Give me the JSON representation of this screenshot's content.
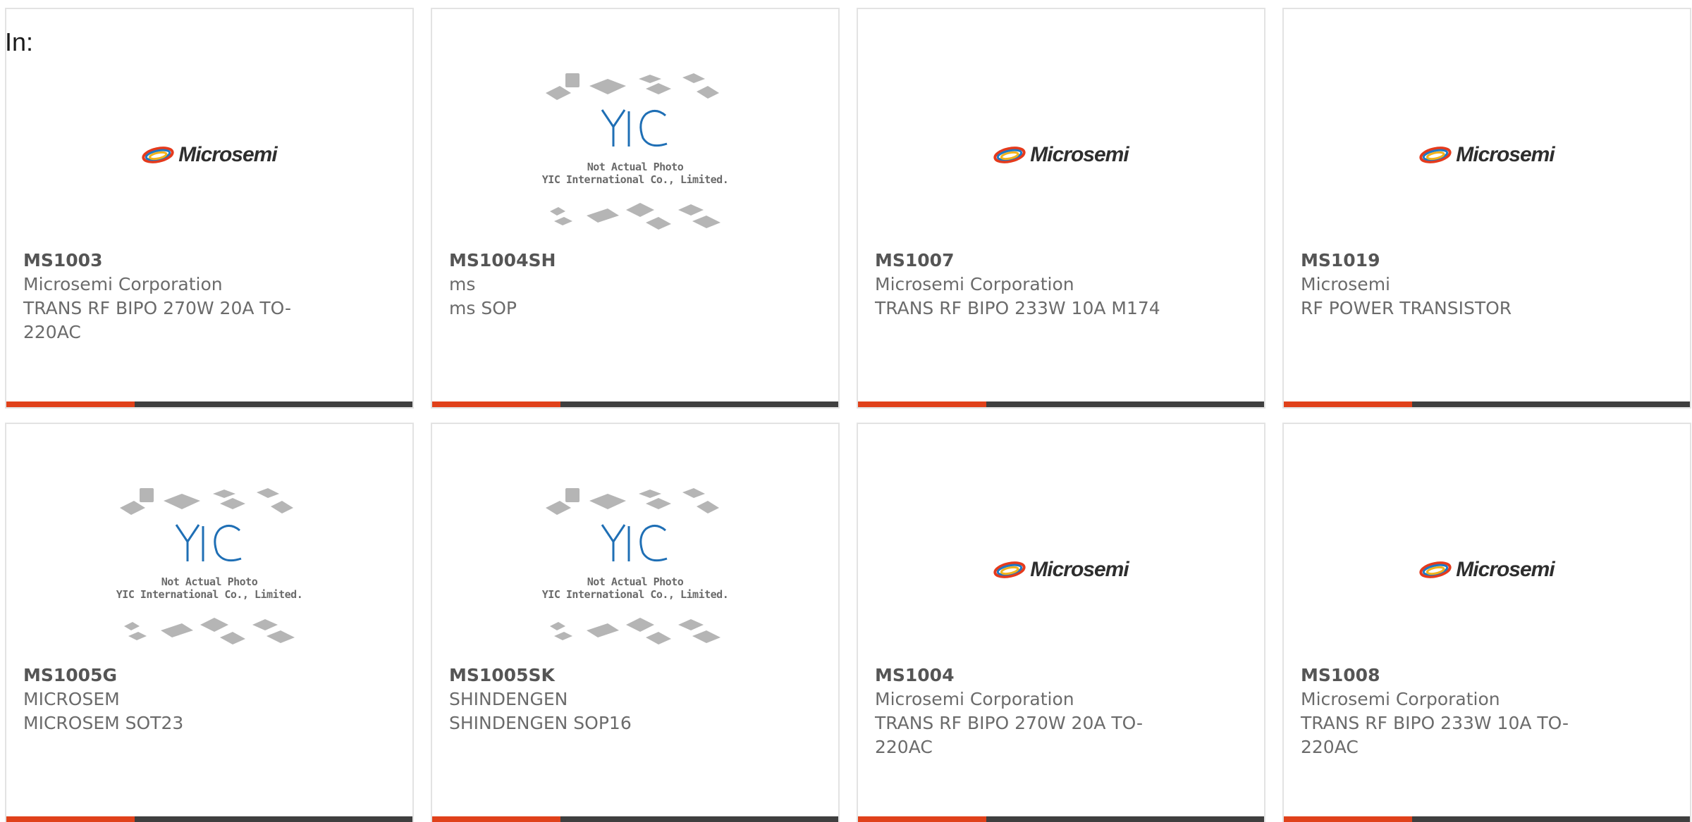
{
  "header": {
    "label": "In:"
  },
  "products": [
    {
      "part_number": "MS1003",
      "manufacturer": "Microsemi Corporation",
      "description": "TRANS RF BIPO 270W 20A TO-220AC",
      "image": "microsemi-logo",
      "logo_text": "Microsemi"
    },
    {
      "part_number": "MS1004SH",
      "manufacturer": "ms",
      "description": "ms SOP",
      "image": "yic-placeholder",
      "placeholder_line1": "Not Actual Photo",
      "placeholder_line2": "YIC International Co., Limited."
    },
    {
      "part_number": "MS1007",
      "manufacturer": "Microsemi Corporation",
      "description": "TRANS RF BIPO 233W 10A M174",
      "image": "microsemi-logo",
      "logo_text": "Microsemi"
    },
    {
      "part_number": "MS1019",
      "manufacturer": "Microsemi",
      "description": "RF POWER TRANSISTOR",
      "image": "microsemi-logo",
      "logo_text": "Microsemi"
    },
    {
      "part_number": "MS1005G",
      "manufacturer": "MICROSEM",
      "description": "MICROSEM SOT23",
      "image": "yic-placeholder",
      "placeholder_line1": "Not Actual Photo",
      "placeholder_line2": "YIC International Co., Limited."
    },
    {
      "part_number": "MS1005SK",
      "manufacturer": "SHINDENGEN",
      "description": "SHINDENGEN SOP16",
      "image": "yic-placeholder",
      "placeholder_line1": "Not Actual Photo",
      "placeholder_line2": "YIC International Co., Limited."
    },
    {
      "part_number": "MS1004",
      "manufacturer": "Microsemi Corporation",
      "description": "TRANS RF BIPO 270W 20A TO-220AC",
      "image": "microsemi-logo",
      "logo_text": "Microsemi"
    },
    {
      "part_number": "MS1008",
      "manufacturer": "Microsemi Corporation",
      "description": "TRANS RF BIPO 233W 10A TO-220AC",
      "image": "microsemi-logo",
      "logo_text": "Microsemi"
    }
  ],
  "colors": {
    "accent": "#e0411a",
    "bar": "#3f3f3f",
    "yic_blue": "#1f6fb5"
  }
}
